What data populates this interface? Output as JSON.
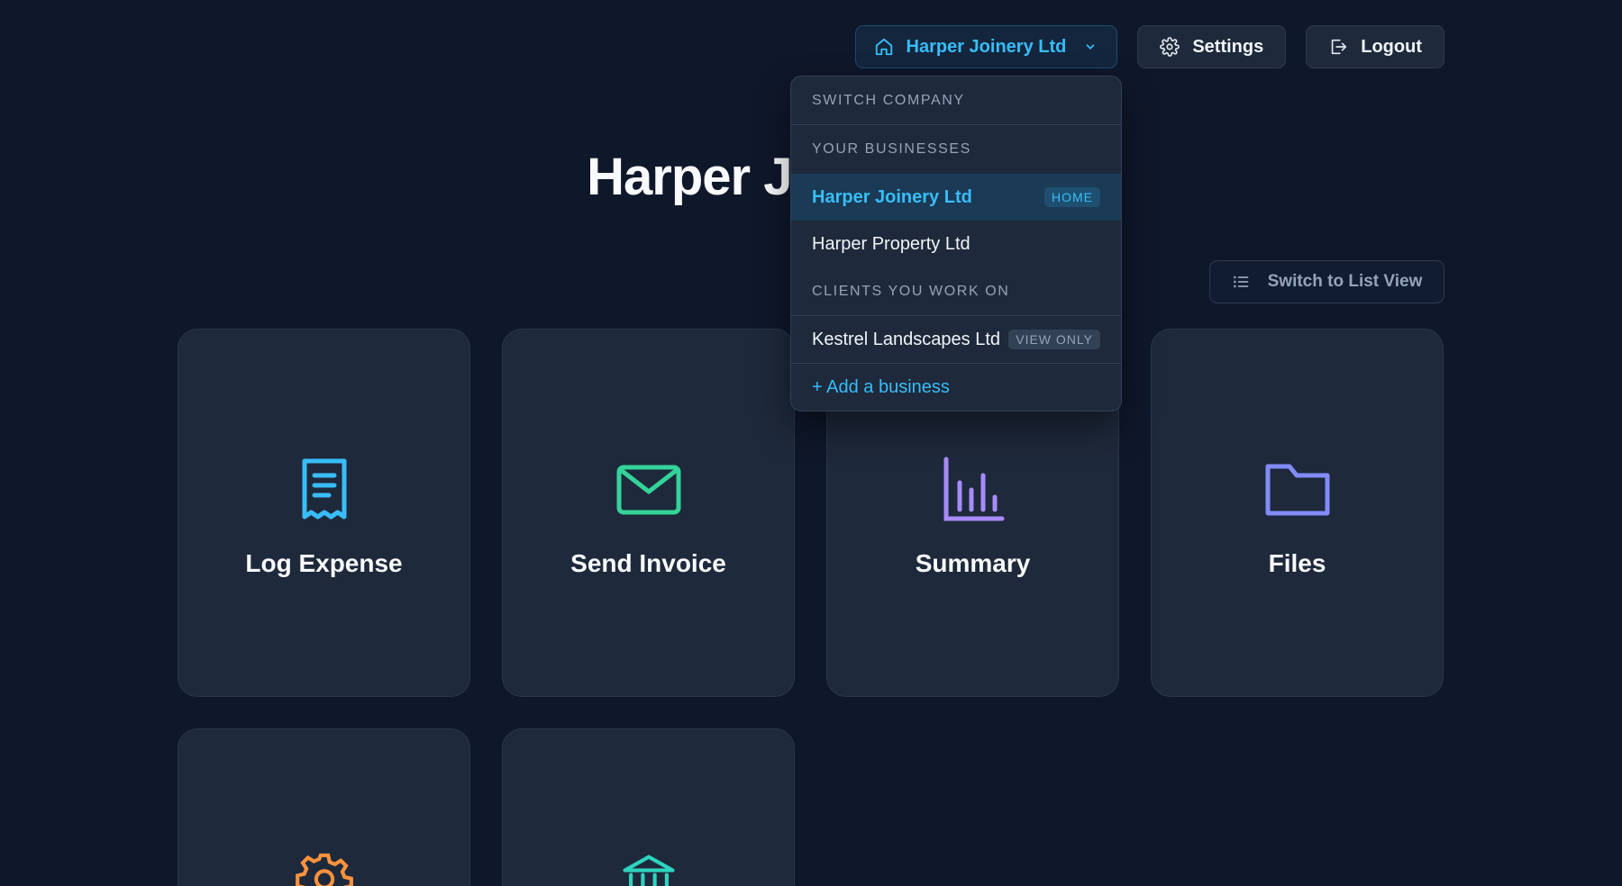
{
  "topbar": {
    "company_label": "Harper Joinery Ltd",
    "settings_label": "Settings",
    "logout_label": "Logout"
  },
  "page_title": "Harper Joinery Ltd",
  "list_view_label": "Switch to List View",
  "cards": [
    {
      "label": "Log Expense",
      "icon": "receipt-icon",
      "color": "#38bdf8"
    },
    {
      "label": "Send Invoice",
      "icon": "envelope-icon",
      "color": "#34d399"
    },
    {
      "label": "Summary",
      "icon": "bar-chart-icon",
      "color": "#a78bfa"
    },
    {
      "label": "Files",
      "icon": "folder-icon",
      "color": "#818cf8"
    },
    {
      "label": "",
      "icon": "gear-icon",
      "color": "#fb923c"
    },
    {
      "label": "",
      "icon": "bank-icon",
      "color": "#2dd4bf"
    }
  ],
  "dropdown": {
    "header": "SWITCH COMPANY",
    "section_businesses": "YOUR BUSINESSES",
    "businesses": [
      {
        "name": "Harper Joinery Ltd",
        "badge": "HOME"
      },
      {
        "name": "Harper Property Ltd"
      }
    ],
    "section_clients": "CLIENTS YOU WORK ON",
    "clients": [
      {
        "name": "Kestrel Landscapes Ltd",
        "badge": "VIEW ONLY"
      }
    ],
    "add_label": "+ Add a business"
  }
}
